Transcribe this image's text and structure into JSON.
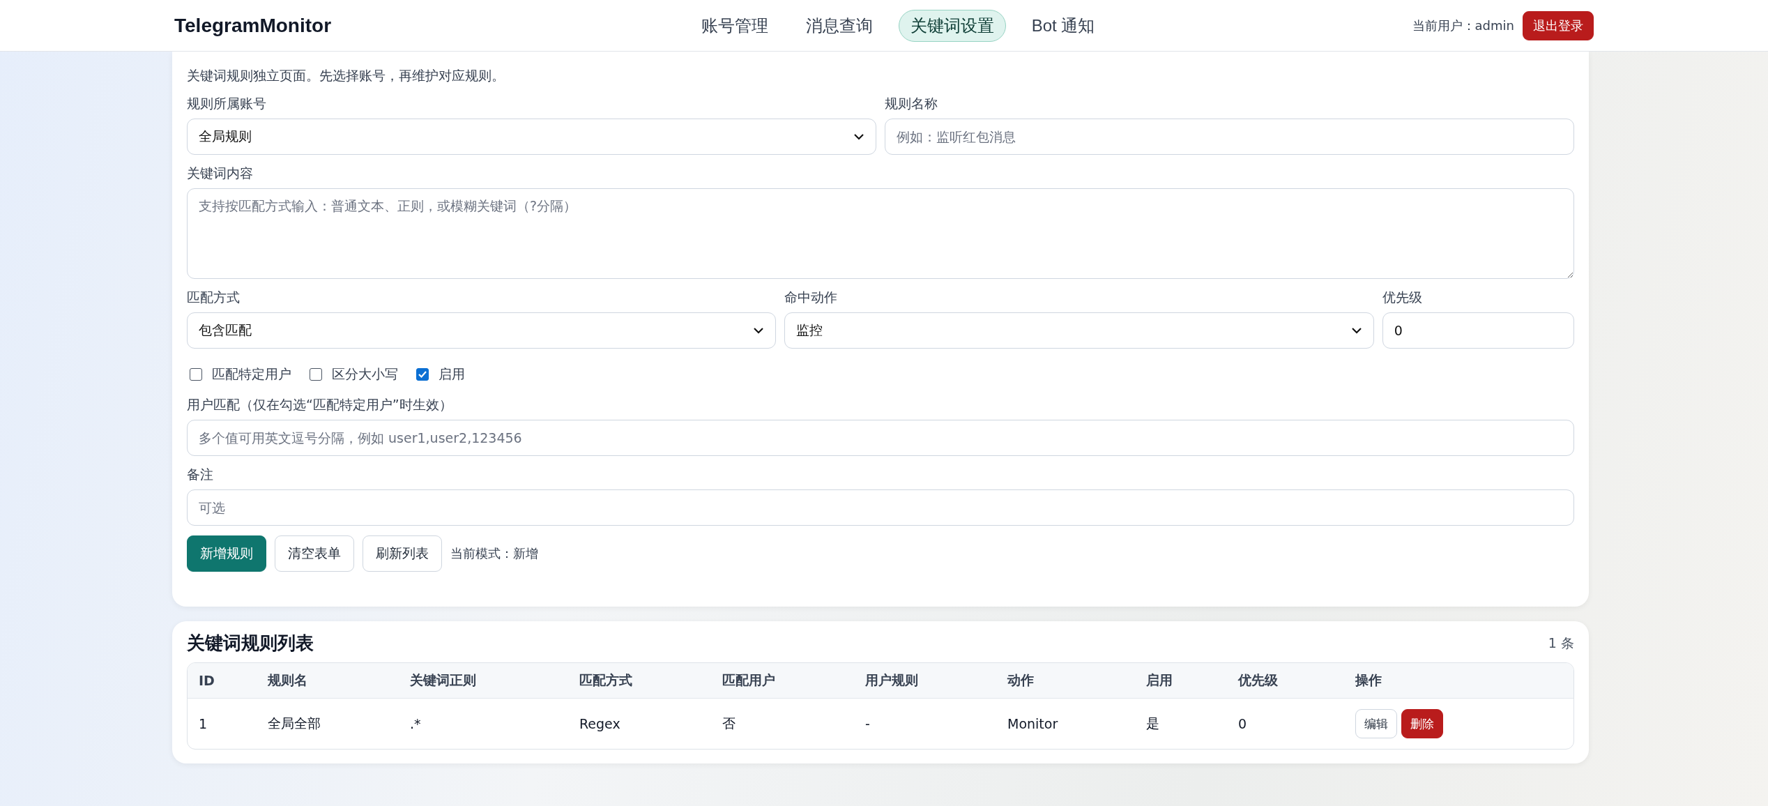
{
  "header": {
    "logo": "TelegramMonitor",
    "nav": [
      {
        "label": "账号管理",
        "selected": false
      },
      {
        "label": "消息查询",
        "selected": false
      },
      {
        "label": "关键词设置",
        "selected": true
      },
      {
        "label": "Bot 通知",
        "selected": false
      }
    ],
    "current_user": "当前用户：admin",
    "logout": "退出登录"
  },
  "form": {
    "description": "关键词规则独立页面。先选择账号，再维护对应规则。",
    "account": {
      "label": "规则所属账号",
      "value": "全局规则"
    },
    "rule_name": {
      "label": "规则名称",
      "placeholder": "例如：监听红包消息"
    },
    "keyword": {
      "label": "关键词内容",
      "placeholder": "支持按匹配方式输入：普通文本、正则，或模糊关键词（?分隔）"
    },
    "match_mode": {
      "label": "匹配方式",
      "value": "包含匹配"
    },
    "action": {
      "label": "命中动作",
      "value": "监控"
    },
    "priority": {
      "label": "优先级",
      "value": "0"
    },
    "checks": [
      {
        "label": "匹配特定用户",
        "checked": false
      },
      {
        "label": "区分大小写",
        "checked": false
      },
      {
        "label": "启用",
        "checked": true
      }
    ],
    "user_match": {
      "label": "用户匹配（仅在勾选“匹配特定用户”时生效）",
      "placeholder": "多个值可用英文逗号分隔，例如 user1,user2,123456"
    },
    "note": {
      "label": "备注",
      "placeholder": "可选"
    },
    "buttons": [
      {
        "label": "新增规则",
        "kind": "primary"
      },
      {
        "label": "清空表单",
        "kind": "secondary"
      },
      {
        "label": "刷新列表",
        "kind": "secondary"
      }
    ],
    "mode": "当前模式：新增"
  },
  "list": {
    "title": "关键词规则列表",
    "count": "1 条",
    "columns": [
      "ID",
      "规则名",
      "关键词正则",
      "匹配方式",
      "匹配用户",
      "用户规则",
      "动作",
      "启用",
      "优先级",
      "操作"
    ],
    "rows": [
      {
        "cells": [
          "1",
          "全局全部",
          ".*",
          "Regex",
          "否",
          "-",
          "Monitor",
          "是",
          "0"
        ],
        "actions": [
          {
            "label": "编辑",
            "kind": "secondary"
          },
          {
            "label": "删除",
            "kind": "danger"
          }
        ]
      }
    ]
  }
}
